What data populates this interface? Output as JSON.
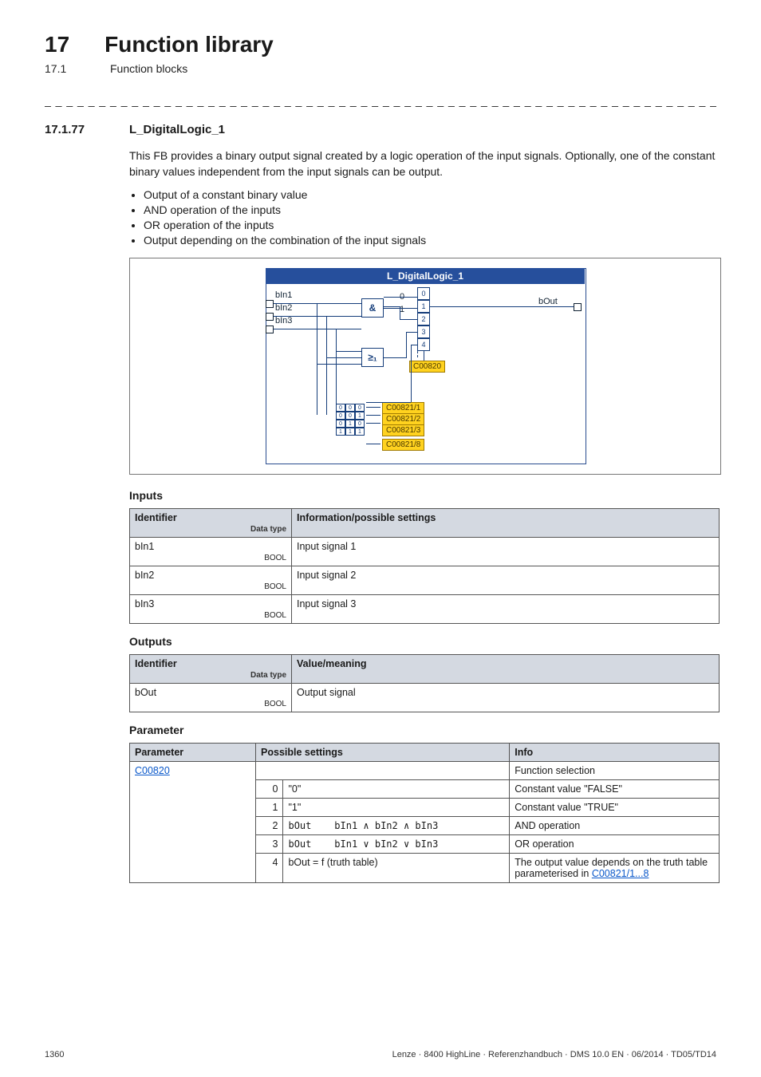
{
  "chapter": {
    "num": "17",
    "title": "Function library"
  },
  "sub": {
    "num": "17.1",
    "title": "Function blocks"
  },
  "dashes": "_ _ _ _ _ _ _ _ _ _ _ _ _ _ _ _ _ _ _ _ _ _ _ _ _ _ _ _ _ _ _ _ _ _ _ _ _ _ _ _ _ _ _ _ _ _ _ _ _ _ _ _ _ _ _ _ _ _ _ _ _ _ _ _",
  "section": {
    "num": "17.1.77",
    "title": "L_DigitalLogic_1"
  },
  "intro": "This FB provides a binary output signal created by a logic operation of the input signals. Optionally, one of the constant binary values independent from the input signals can be output.",
  "bullets": [
    "Output of a constant binary value",
    "AND operation of the inputs",
    "OR operation of the inputs",
    "Output depending on the combination of the input signals"
  ],
  "diagram": {
    "title": "L_DigitalLogic_1",
    "inputs": [
      "bIn1",
      "bIn2",
      "bIn3"
    ],
    "gates": {
      "and": "&",
      "or": "≥₁"
    },
    "out_label": "bOut",
    "mux_presel": [
      "0",
      "1"
    ],
    "mux_slots": [
      "0",
      "1",
      "2",
      "3",
      "4"
    ],
    "sel_tag": "C00820",
    "truth_tags": [
      "C00821/1",
      "C00821/2",
      "C00821/3",
      "C00821/8"
    ],
    "truth_cells": [
      [
        "0",
        "0",
        "0"
      ],
      [
        "0",
        "0",
        "1"
      ],
      [
        "0",
        "1",
        "0"
      ],
      [
        "1",
        "1",
        "1"
      ]
    ]
  },
  "inputs_heading": "Inputs",
  "inputs_table": {
    "headers": {
      "id": "Identifier",
      "dtype": "Data type",
      "info": "Information/possible settings"
    },
    "rows": [
      {
        "id": "bIn1",
        "dtype": "BOOL",
        "info": "Input signal 1"
      },
      {
        "id": "bIn2",
        "dtype": "BOOL",
        "info": "Input signal 2"
      },
      {
        "id": "bIn3",
        "dtype": "BOOL",
        "info": "Input signal 3"
      }
    ]
  },
  "outputs_heading": "Outputs",
  "outputs_table": {
    "headers": {
      "id": "Identifier",
      "dtype": "Data type",
      "info": "Value/meaning"
    },
    "rows": [
      {
        "id": "bOut",
        "dtype": "BOOL",
        "info": "Output signal"
      }
    ]
  },
  "param_heading": "Parameter",
  "param_table": {
    "headers": {
      "p": "Parameter",
      "ps": "Possible settings",
      "info": "Info"
    },
    "param_code": "C00820",
    "info_top": "Function selection",
    "rows": [
      {
        "n": "0",
        "setting": "\"0\"",
        "info": "Constant value \"FALSE\""
      },
      {
        "n": "1",
        "setting": "\"1\"",
        "info": "Constant value \"TRUE\""
      },
      {
        "n": "2",
        "setting_pre": "bOut",
        "setting_expr": "bIn1 ∧ bIn2 ∧ bIn3",
        "info": "AND operation"
      },
      {
        "n": "3",
        "setting_pre": "bOut",
        "setting_expr": "bIn1 ∨ bIn2 ∨ bIn3",
        "info": "OR operation"
      },
      {
        "n": "4",
        "setting": "bOut = f (truth table)",
        "info_pre": "The output value depends on the truth table parameterised in ",
        "info_link": "C00821/1...8"
      }
    ]
  },
  "footer": {
    "page": "1360",
    "meta": "Lenze · 8400 HighLine · Referenzhandbuch · DMS 10.0 EN · 06/2014 · TD05/TD14"
  }
}
